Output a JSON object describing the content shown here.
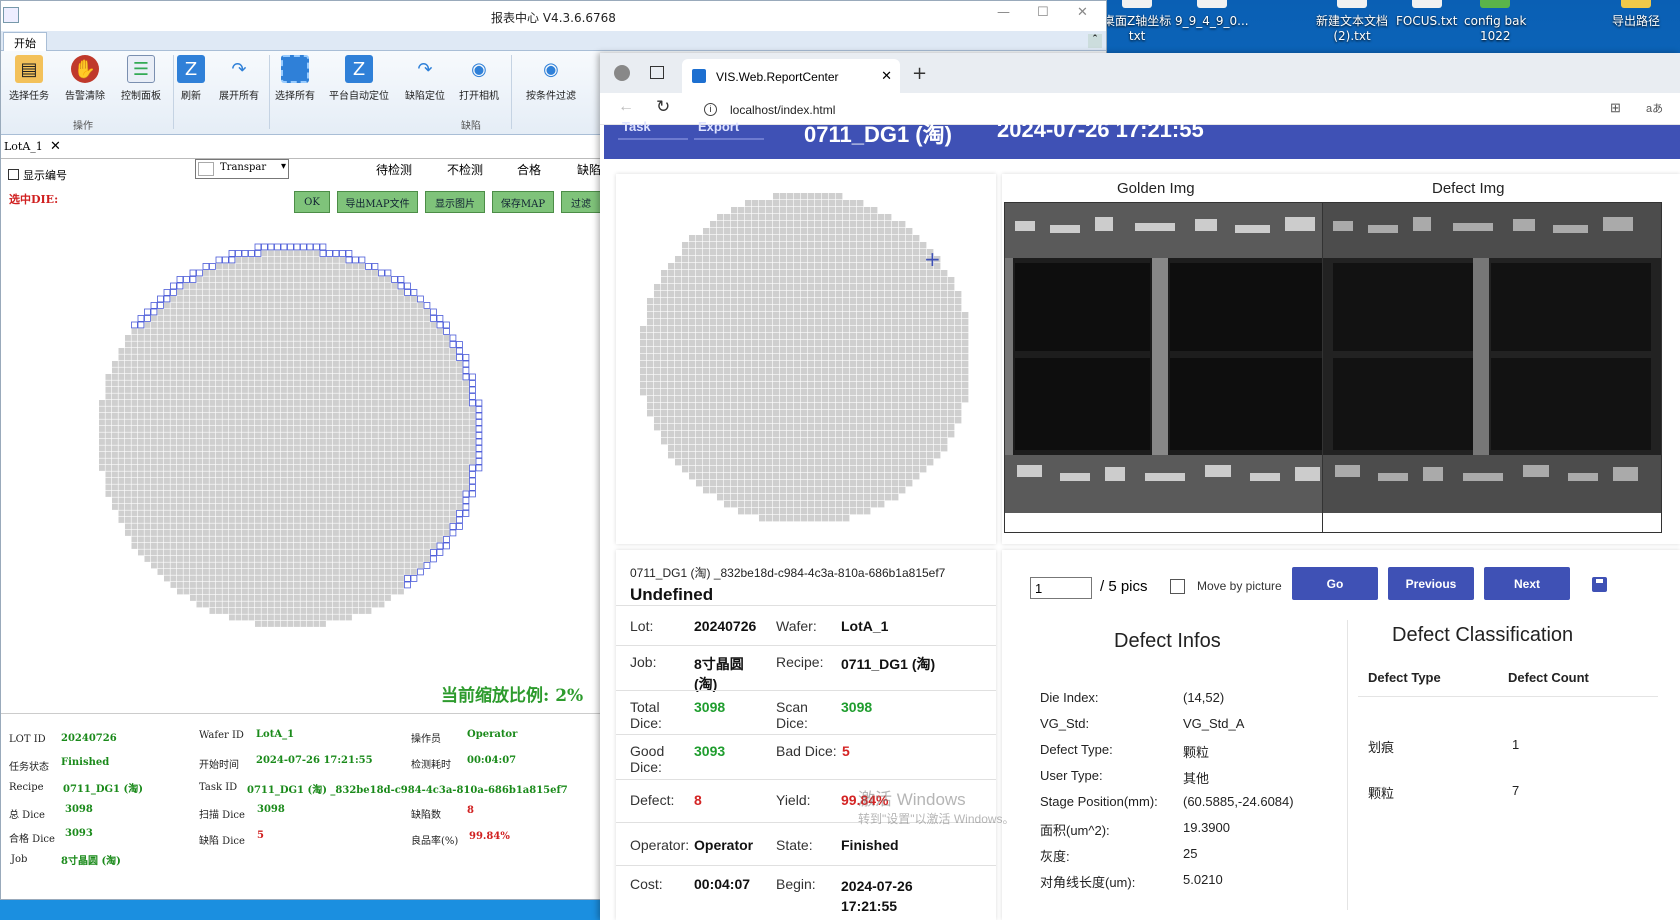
{
  "desktop": {
    "icons": [
      "桌面Z轴坐标\ntxt",
      "9_9_4_9_0...",
      "新建文本文档\n(2).txt",
      "FOCUS.txt",
      "config bak\n1022",
      "导出路径"
    ]
  },
  "app": {
    "title": "报表中心 V4.3.6.6768",
    "tab_start": "开始",
    "ribbon": {
      "buttons": [
        "选择任务",
        "告警清除",
        "控制面板",
        "刷新",
        "展开所有",
        "选择所有",
        "平台自动定位",
        "缺陷定位",
        "打开相机",
        "按条件过滤"
      ],
      "group_ops": "操作",
      "group_defect": "缺陷"
    },
    "doc_tab": "LotA_1",
    "doc_tab_close": "✕",
    "show_number": "显示编号",
    "selected_die": "选中DIE:",
    "transparency": "Transpar",
    "status_headers": [
      "待检测",
      "不检测",
      "合格",
      "缺陷"
    ],
    "buttons": [
      "OK",
      "导出MAP文件",
      "显示图片",
      "保存MAP",
      "过滤"
    ],
    "zoom_ratio": "当前缩放比例: 2%",
    "info": {
      "lot_id_label": "LOT ID",
      "lot_id": "20240726",
      "wafer_id_label": "Wafer ID",
      "wafer_id": "LotA_1",
      "operator_label": "操作员",
      "operator": "Operator",
      "task_state_label": "任务状态",
      "task_state": "Finished",
      "start_time_label": "开始时间",
      "start_time": "2024-07-26 17:21:55",
      "elapsed_label": "检测耗时",
      "elapsed": "00:04:07",
      "recipe_label": "Recipe",
      "recipe": "0711_DG1 (淘)",
      "task_id_label": "Task ID",
      "task_id": "0711_DG1 (淘) _832be18d-c984-4c3a-810a-686b1a815ef7",
      "total_dice_label": "总 Dice",
      "total_dice": "3098",
      "scan_dice_label": "扫描 Dice",
      "scan_dice": "3098",
      "defect_count_label": "缺陷数",
      "defect_count": "8",
      "good_dice_label": "合格 Dice",
      "good_dice": "3093",
      "bad_dice_label": "缺陷 Dice",
      "bad_dice": "5",
      "yield_label": "良品率(%)",
      "yield": "99.84%",
      "job_label": "Job",
      "job": "8寸晶圆 (淘)"
    }
  },
  "browser": {
    "tab_title": "VIS.Web.ReportCenter",
    "url": "localhost/index.html",
    "header": {
      "task_btn": "Task",
      "export_btn": "Export",
      "title": "0711_DG1 (淘)",
      "date": "2024-07-26 17:21:55"
    },
    "golden_title": "Golden Img",
    "defect_title": "Defect Img",
    "task_line": "0711_DG1 (淘) _832be18d-c984-4c3a-810a-686b1a815ef7",
    "task_status": "Undefined",
    "info": {
      "lot_k": "Lot:",
      "lot_v": "20240726",
      "wafer_k": "Wafer:",
      "wafer_v": "LotA_1",
      "job_k": "Job:",
      "job_v": "8寸晶圆 (淘)",
      "recipe_k": "Recipe:",
      "recipe_v": "0711_DG1 (淘)",
      "total_k": "Total Dice:",
      "total_v": "3098",
      "scan_k": "Scan Dice:",
      "scan_v": "3098",
      "good_k": "Good Dice:",
      "good_v": "3093",
      "bad_k": "Bad Dice:",
      "bad_v": "5",
      "defect_k": "Defect:",
      "defect_v": "8",
      "yield_k": "Yield:",
      "yield_v": "99.84%",
      "operator_k": "Operator:",
      "operator_v": "Operator",
      "state_k": "State:",
      "state_v": "Finished",
      "cost_k": "Cost:",
      "cost_v": "00:04:07",
      "begin_k": "Begin:",
      "begin_v": "2024-07-26 17:21:55"
    },
    "nav": {
      "page_value": "1",
      "page_total": "/ 5 pics",
      "move_label": "Move by picture",
      "go": "Go",
      "previous": "Previous",
      "next": "Next"
    },
    "defect_infos": {
      "title": "Defect Infos",
      "rows": [
        {
          "k": "Die Index:",
          "v": "(14,52)"
        },
        {
          "k": "VG_Std:",
          "v": "VG_Std_A"
        },
        {
          "k": "Defect Type:",
          "v": "颗粒"
        },
        {
          "k": "User Type:",
          "v": "其他"
        },
        {
          "k": "Stage Position(mm):",
          "v": "(60.5885,-24.6084)"
        },
        {
          "k": "面积(um^2):",
          "v": "19.3900"
        },
        {
          "k": "灰度:",
          "v": "25"
        },
        {
          "k": "对角线长度(um):",
          "v": "5.0210"
        }
      ]
    },
    "classification": {
      "title": "Defect Classification",
      "col_type": "Defect Type",
      "col_count": "Defect Count",
      "rows": [
        {
          "type": "划痕",
          "count": "1"
        },
        {
          "type": "颗粒",
          "count": "7"
        }
      ]
    },
    "watermark": "激活 Windows",
    "watermark_sub": "转到\"设置\"以激活 Windows。"
  },
  "colors": {
    "header_blue": "#3f51b5",
    "pass_green": "#1f9d2e",
    "fail_red": "#d42424",
    "defect_die": "#4a5ad8"
  }
}
